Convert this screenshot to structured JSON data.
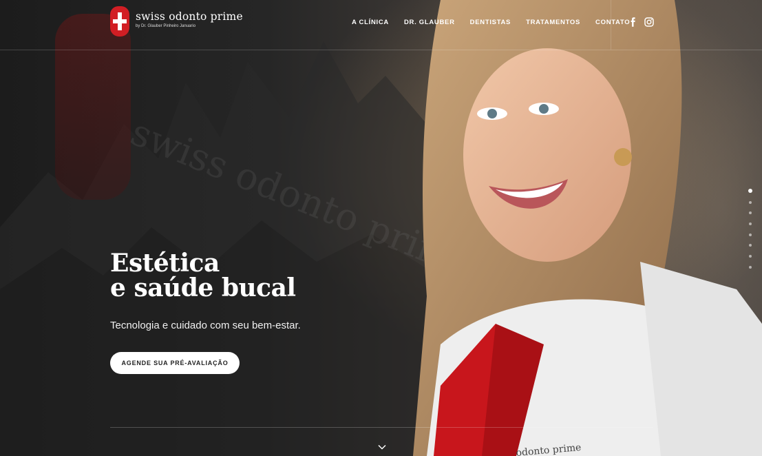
{
  "brand": {
    "name": "swiss odonto prime",
    "tagline": "by Dr. Glauber Pinheiro Januario",
    "color": "#d21e24"
  },
  "nav": {
    "items": [
      {
        "label": "A CLÍNICA"
      },
      {
        "label": "DR. GLAUBER"
      },
      {
        "label": "DENTISTAS"
      },
      {
        "label": "TRATAMENTOS"
      },
      {
        "label": "CONTATO"
      }
    ]
  },
  "social": {
    "icons": [
      "facebook-icon",
      "instagram-icon"
    ]
  },
  "hero": {
    "title_line1": "Estética",
    "title_line2": "e saúde bucal",
    "subtitle": "Tecnologia e cuidado com seu bem-estar.",
    "cta_label": "AGENDE SUA PRÉ-AVALIAÇÃO"
  },
  "background": {
    "wordmark": "swiss odonto prime"
  },
  "pagination": {
    "total": 8,
    "active": 1
  }
}
